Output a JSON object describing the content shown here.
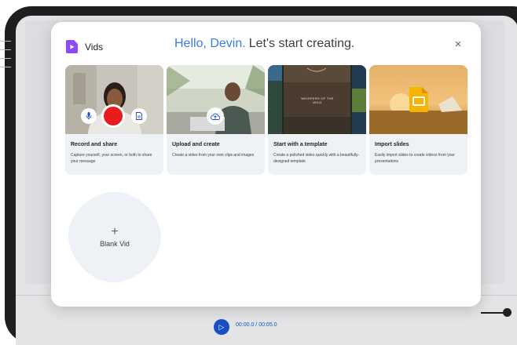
{
  "app": {
    "name": "Vids",
    "brand_color": "#8b4cf6"
  },
  "dialog": {
    "greeting_name": "Hello, Devin.",
    "greeting_rest": "Let's start creating.",
    "close_icon": "close-icon",
    "close_glyph": "×"
  },
  "cards": [
    {
      "title": "Record and share",
      "description": "Capture yourself, your screen, or both to share your message",
      "icons": [
        "mic-icon",
        "record-icon",
        "notes-icon"
      ]
    },
    {
      "title": "Upload and create",
      "description": "Create a video from your own clips and images",
      "icons": [
        "cloud-upload-icon"
      ]
    },
    {
      "title": "Start with a template",
      "description": "Create a polished video quickly with a beautifully-designed template",
      "thumbnail_text": "WHISPERS OF THE WILD"
    },
    {
      "title": "Import slides",
      "description": "Easily import slides to create videos from your presentations",
      "icons": [
        "slides-icon"
      ]
    }
  ],
  "blank": {
    "plus": "+",
    "label": "Blank Vid"
  },
  "player": {
    "timecode": "00:00.0 / 00:05.0",
    "play_icon": "play-icon",
    "play_glyph": "▷"
  },
  "colors": {
    "accent_blue": "#3b7be8",
    "record_red": "#ea1b1b",
    "card_bg": "#eef1f6"
  }
}
